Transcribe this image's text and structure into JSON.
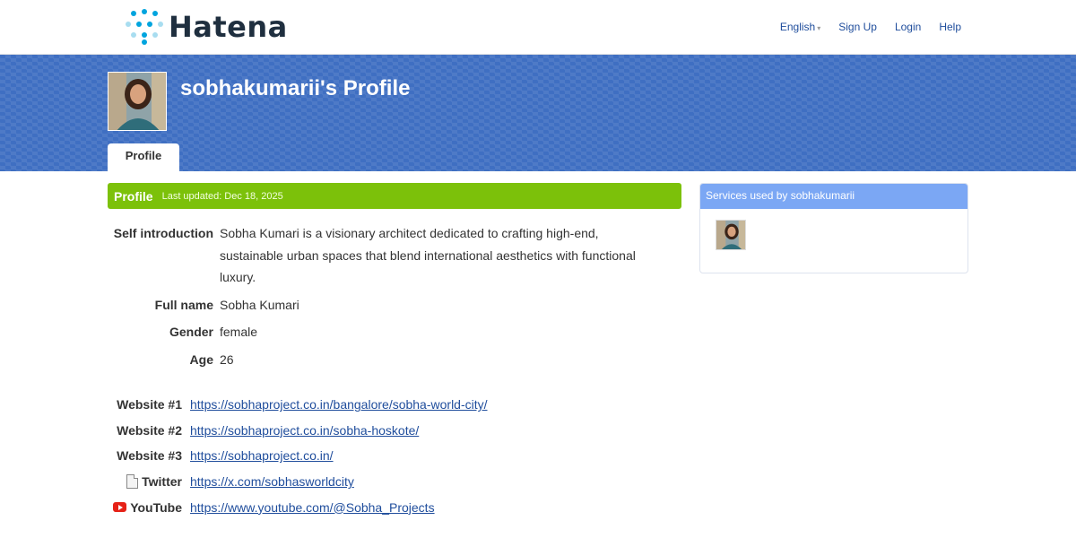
{
  "header": {
    "logo_text": "Hatena",
    "nav": {
      "language": "English",
      "sign_up": "Sign Up",
      "login": "Login",
      "help": "Help"
    }
  },
  "banner": {
    "title": "sobhakumarii's Profile",
    "tab_label": "Profile"
  },
  "profile": {
    "section_title": "Profile",
    "last_updated": "Last updated: Dec 18, 2025",
    "fields": [
      {
        "label": "Self introduction",
        "value": "Sobha Kumari is a visionary architect dedicated to crafting high-end, sustainable urban spaces that blend international aesthetics with functional luxury."
      },
      {
        "label": "Full name",
        "value": "Sobha Kumari"
      },
      {
        "label": "Gender",
        "value": "female"
      },
      {
        "label": "Age",
        "value": "26"
      }
    ],
    "links": [
      {
        "label": "Website #1",
        "url": "https://sobhaproject.co.in/bangalore/sobha-world-city/",
        "icon": ""
      },
      {
        "label": "Website #2",
        "url": "https://sobhaproject.co.in/sobha-hoskote/",
        "icon": ""
      },
      {
        "label": "Website #3",
        "url": "https://sobhaproject.co.in/",
        "icon": ""
      },
      {
        "label": "Twitter",
        "url": "https://x.com/sobhasworldcity",
        "icon": "document-icon"
      },
      {
        "label": "YouTube",
        "url": "https://www.youtube.com/@Sobha_Projects",
        "icon": "youtube-icon"
      }
    ]
  },
  "sidebar": {
    "title": "Services used by sobhakumarii"
  },
  "colors": {
    "banner": "#3f6fc2",
    "section_header": "#7cc10a",
    "sidebar_header": "#7ba7f4",
    "link": "#1f4d9c"
  }
}
